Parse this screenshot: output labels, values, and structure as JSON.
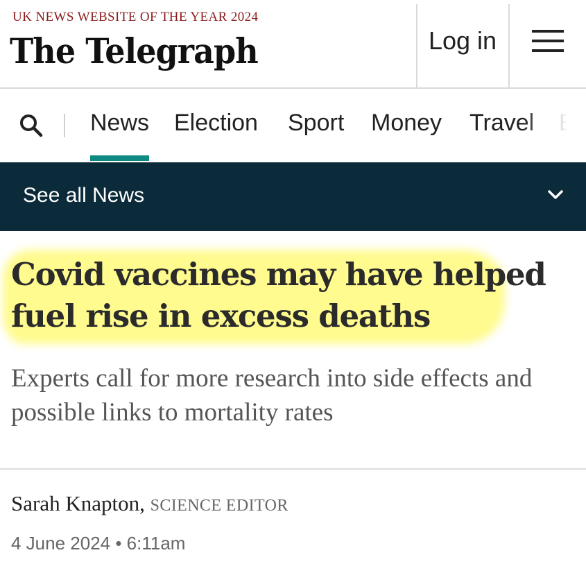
{
  "header": {
    "award": "UK NEWS WEBSITE OF THE YEAR 2024",
    "logo": "The Telegraph",
    "login_label": "Log in",
    "menu_icon": "hamburger-icon"
  },
  "nav": {
    "search_icon": "search-icon",
    "items": [
      "News",
      "Election",
      "Sport",
      "Money",
      "Travel",
      "B"
    ],
    "active": "News",
    "accent_color": "#0e8a83"
  },
  "section_bar": {
    "label": "See all News",
    "icon": "chevron-down-icon",
    "background": "#0b2b3a"
  },
  "article": {
    "headline": "Covid vaccines may have helped fuel rise in excess deaths",
    "standfirst": "Experts call for more research into side effects and possible links to mortality rates",
    "author": "Sarah Knapton,",
    "author_role": "SCIENCE EDITOR",
    "timestamp": "4 June 2024 • 6:11am",
    "highlight_color": "#fff96e"
  }
}
